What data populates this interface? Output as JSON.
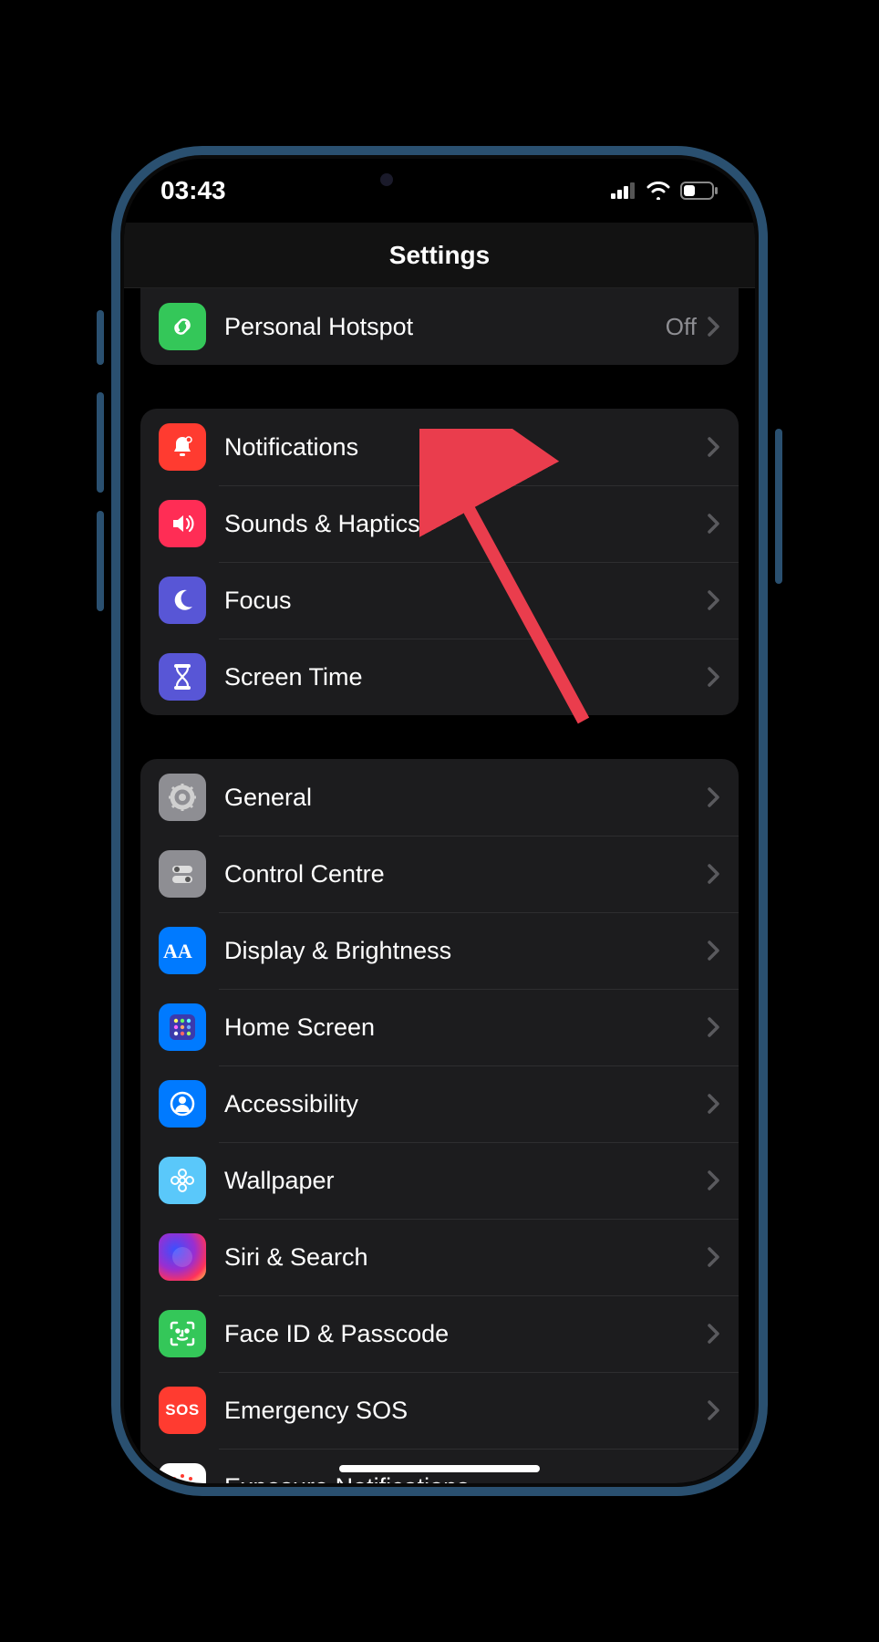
{
  "status": {
    "time": "03:43"
  },
  "header": {
    "title": "Settings"
  },
  "groups": [
    {
      "rows": [
        {
          "id": "personal-hotspot",
          "label": "Personal Hotspot",
          "value": "Off",
          "icon": "link-icon",
          "bg": "bg-green"
        }
      ],
      "partialTop": true
    },
    {
      "rows": [
        {
          "id": "notifications",
          "label": "Notifications",
          "value": "",
          "icon": "bell-icon",
          "bg": "bg-red"
        },
        {
          "id": "sounds-haptics",
          "label": "Sounds & Haptics",
          "value": "",
          "icon": "speaker-icon",
          "bg": "bg-pink"
        },
        {
          "id": "focus",
          "label": "Focus",
          "value": "",
          "icon": "moon-icon",
          "bg": "bg-indigo"
        },
        {
          "id": "screen-time",
          "label": "Screen Time",
          "value": "",
          "icon": "hourglass-icon",
          "bg": "bg-indigo"
        }
      ]
    },
    {
      "rows": [
        {
          "id": "general",
          "label": "General",
          "value": "",
          "icon": "gear-icon",
          "bg": "bg-gray"
        },
        {
          "id": "control-centre",
          "label": "Control Centre",
          "value": "",
          "icon": "toggles-icon",
          "bg": "bg-gray"
        },
        {
          "id": "display-brightness",
          "label": "Display & Brightness",
          "value": "",
          "icon": "aa-icon",
          "bg": "bg-blue"
        },
        {
          "id": "home-screen",
          "label": "Home Screen",
          "value": "",
          "icon": "grid-icon",
          "bg": "bg-blue"
        },
        {
          "id": "accessibility",
          "label": "Accessibility",
          "value": "",
          "icon": "person-icon",
          "bg": "bg-blue"
        },
        {
          "id": "wallpaper",
          "label": "Wallpaper",
          "value": "",
          "icon": "flower-icon",
          "bg": "bg-teal"
        },
        {
          "id": "siri-search",
          "label": "Siri & Search",
          "value": "",
          "icon": "siri-icon",
          "bg": "bg-siri"
        },
        {
          "id": "face-id-passcode",
          "label": "Face ID & Passcode",
          "value": "",
          "icon": "faceid-icon",
          "bg": "bg-green"
        },
        {
          "id": "emergency-sos",
          "label": "Emergency SOS",
          "value": "",
          "icon": "sos-icon",
          "bg": "bg-redsos"
        },
        {
          "id": "exposure-notif",
          "label": "Exposure Notifications",
          "value": "",
          "icon": "exposure-icon",
          "bg": "bg-white"
        }
      ]
    }
  ],
  "annotation": {
    "target": "sounds-haptics",
    "color": "#ea3d4d"
  }
}
